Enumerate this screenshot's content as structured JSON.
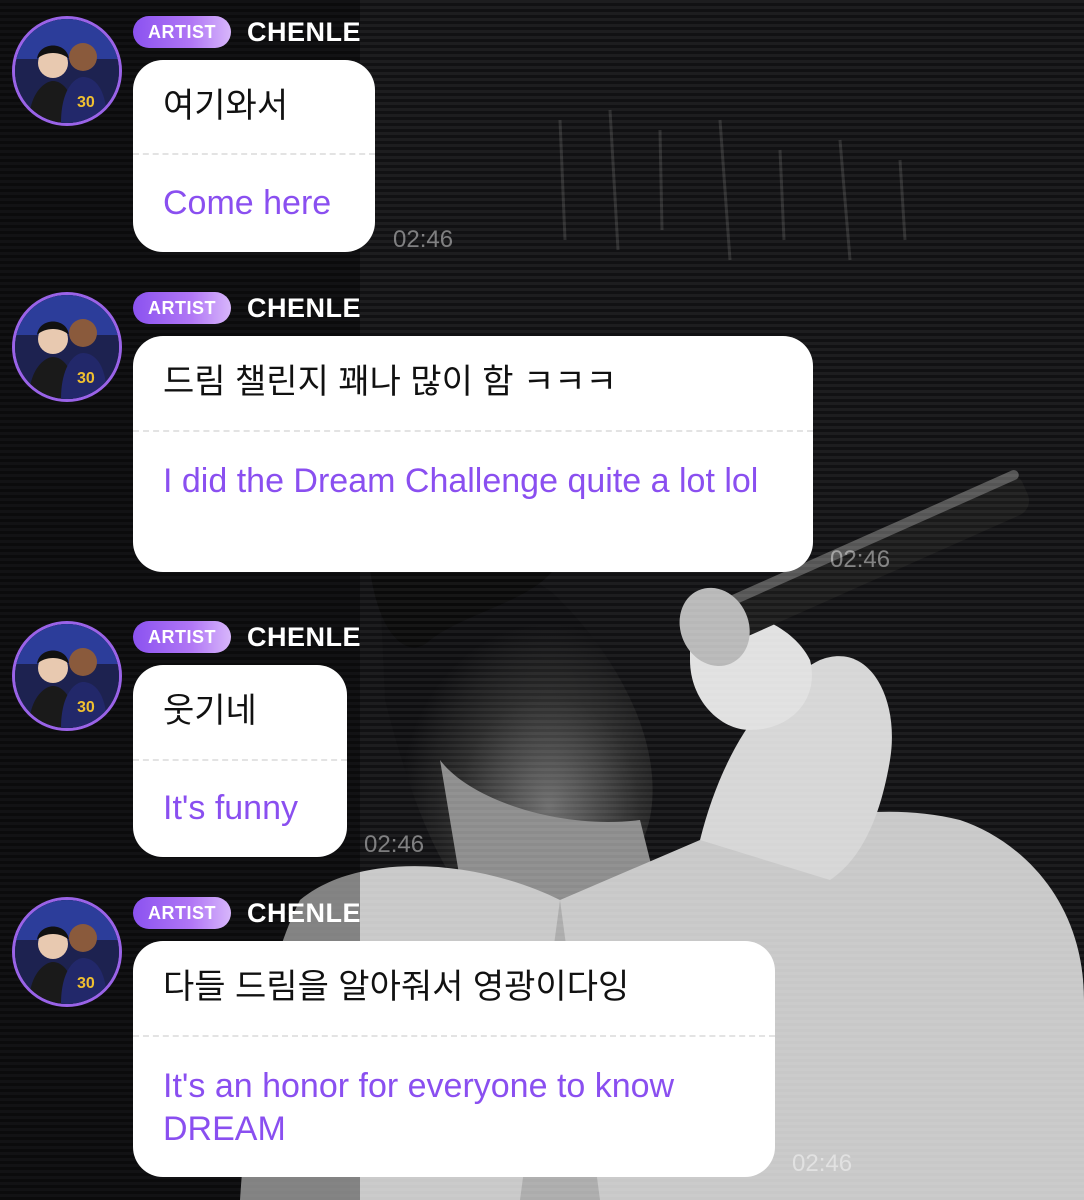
{
  "chat": {
    "messages": [
      {
        "badge": "ARTIST",
        "sender": "CHENLE",
        "original": "여기와서",
        "translation": "Come here",
        "time": "02:46"
      },
      {
        "badge": "ARTIST",
        "sender": "CHENLE",
        "original": "드림 챌린지 꽤나 많이 함 ㅋㅋㅋ",
        "translation": "I did the Dream Challenge quite a lot lol",
        "time": "02:46"
      },
      {
        "badge": "ARTIST",
        "sender": "CHENLE",
        "original": "웃기네",
        "translation": "It's funny",
        "time": "02:46"
      },
      {
        "badge": "ARTIST",
        "sender": "CHENLE",
        "original": "다들 드림을 알아줘서 영광이다잉",
        "translation": "It's an honor for everyone to know DREAM",
        "time": "02:46"
      }
    ]
  },
  "colors": {
    "accent": "#8a4ff0",
    "badge_gradient_start": "#8b52f0",
    "bubble": "#ffffff",
    "background": "#0d0d0f"
  },
  "icons": {
    "avatar": "profile-photo"
  }
}
